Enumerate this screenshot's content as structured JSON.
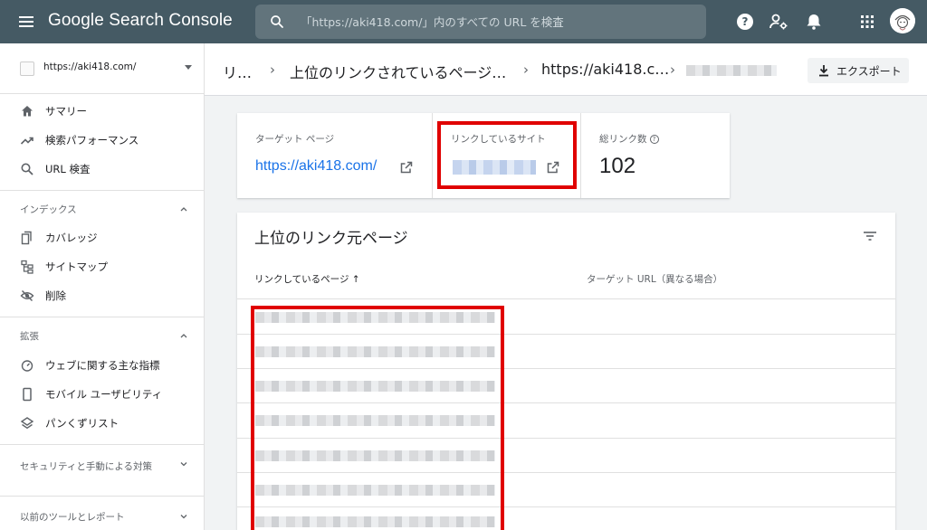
{
  "topbar": {
    "logo": "Google Search Console",
    "search_placeholder": "「https://aki418.com/」内のすべての URL を検査",
    "help_glyph": "?"
  },
  "sidebar": {
    "property_url": "https://aki418.com/",
    "items": [
      {
        "label": "サマリー",
        "icon": "home-icon"
      },
      {
        "label": "検索パフォーマンス",
        "icon": "trending-up-icon"
      },
      {
        "label": "URL 検査",
        "icon": "search-icon"
      }
    ],
    "sections": [
      {
        "label": "インデックス",
        "expanded": true,
        "items": [
          {
            "label": "カバレッジ",
            "icon": "coverage-icon"
          },
          {
            "label": "サイトマップ",
            "icon": "sitemap-icon"
          },
          {
            "label": "削除",
            "icon": "visibility-off-icon"
          }
        ]
      },
      {
        "label": "拡張",
        "expanded": true,
        "items": [
          {
            "label": "ウェブに関する主な指標",
            "icon": "speedometer-icon"
          },
          {
            "label": "モバイル ユーザビリティ",
            "icon": "smartphone-icon"
          },
          {
            "label": "パンくずリスト",
            "icon": "layers-icon"
          }
        ]
      },
      {
        "label": "セキュリティと手動による対策",
        "expanded": false
      },
      {
        "label": "以前のツールとレポート",
        "expanded": false
      }
    ]
  },
  "breadcrumb": {
    "items": [
      "リ…",
      "上位のリンクされているページ…",
      "https://aki418.c…"
    ],
    "separator": "›",
    "last_item_redacted": true
  },
  "export_button": "エクスポート",
  "summary": {
    "target_page": {
      "title": "ターゲット ページ",
      "value": "https://aki418.com/"
    },
    "linking_site": {
      "title": "リンクしているサイト",
      "value_redacted": true
    },
    "total_links": {
      "title": "総リンク数",
      "value": "102"
    }
  },
  "table": {
    "title": "上位のリンク元ページ",
    "columns": [
      "リンクしているページ ↑",
      "ターゲット URL（異なる場合）"
    ],
    "rows_redacted": 7
  },
  "colors": {
    "topbar": "#455a64",
    "link": "#1a73e8",
    "highlight": "#e00000"
  }
}
